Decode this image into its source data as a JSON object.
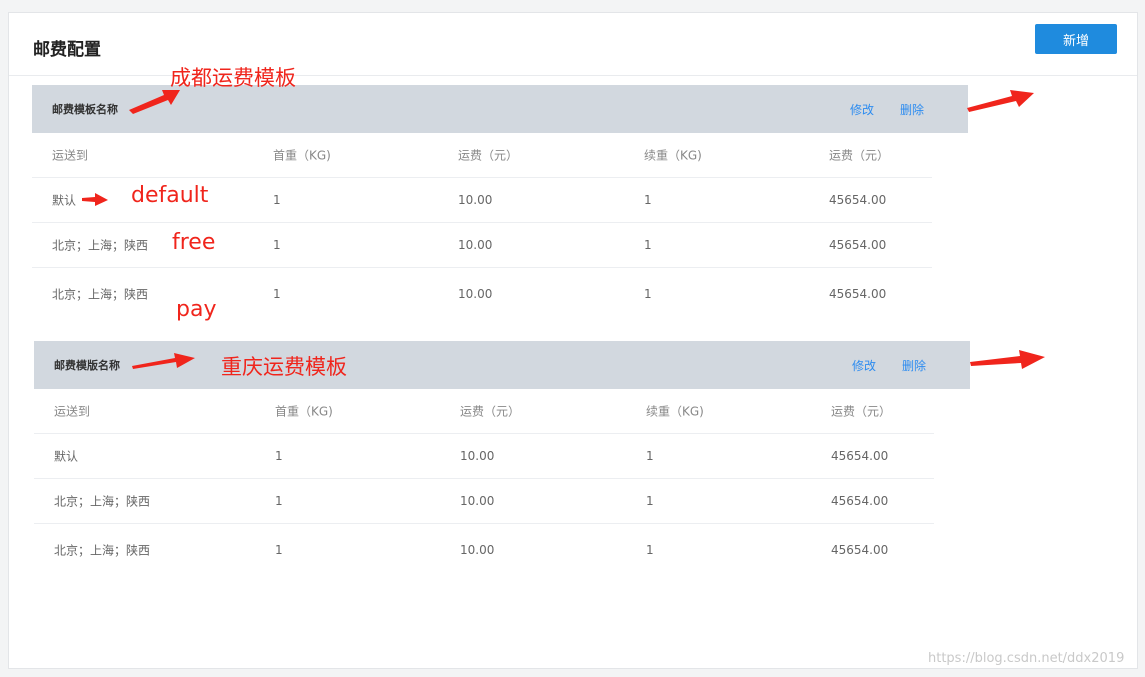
{
  "page": {
    "title": "邮费配置",
    "add_button": "新增"
  },
  "columns": [
    "运送到",
    "首重（KG)",
    "运费（元）",
    "续重（KG)",
    "运费（元）"
  ],
  "templates": [
    {
      "name": "邮费模板名称",
      "edit_label": "修改",
      "delete_label": "删除",
      "rows": [
        [
          "默认",
          "1",
          "10.00",
          "1",
          "45654.00"
        ],
        [
          "北京；上海；陕西",
          "1",
          "10.00",
          "1",
          "45654.00"
        ],
        [
          "北京；上海；陕西",
          "1",
          "10.00",
          "1",
          "45654.00"
        ]
      ]
    },
    {
      "name": "邮费模版名称",
      "edit_label": "修改",
      "delete_label": "删除",
      "rows": [
        [
          "默认",
          "1",
          "10.00",
          "1",
          "45654.00"
        ],
        [
          "北京；上海；陕西",
          "1",
          "10.00",
          "1",
          "45654.00"
        ],
        [
          "北京；上海；陕西",
          "1",
          "10.00",
          "1",
          "45654.00"
        ]
      ]
    }
  ],
  "annotations": {
    "chengdu_template": "成都运费模板",
    "chongqing_template": "重庆运费模板",
    "default_label": "default",
    "free_label": "free",
    "pay_label": "pay"
  },
  "watermark": "https://blog.csdn.net/ddx2019",
  "colors": {
    "accent": "#1f8bde",
    "link": "#2d8cf0",
    "annotation": "#f0251c",
    "template_bar": "#d2d8df"
  }
}
